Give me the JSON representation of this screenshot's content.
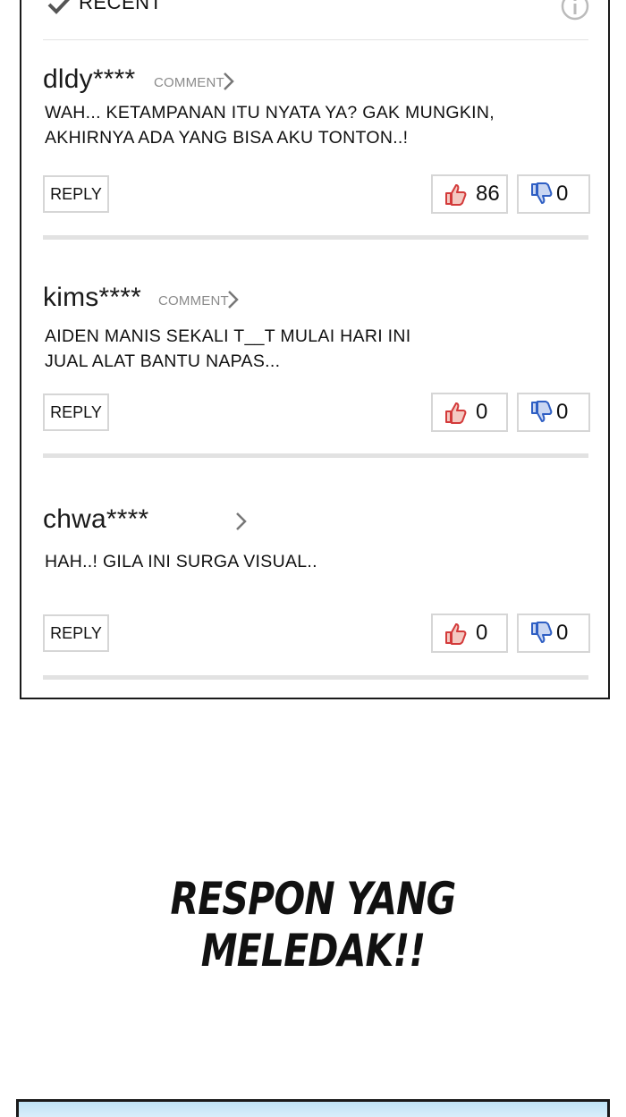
{
  "header": {
    "recent_label": "RECENT"
  },
  "comments": [
    {
      "username": "dldy****",
      "link_label": "COMMENT",
      "text_line1": "WAH... KETAMPANAN ITU NYATA YA? GAK MUNGKIN,",
      "text_line2": "AKHIRNYA ADA YANG BISA AKU TONTON..!",
      "reply_label": "REPLY",
      "likes": "86",
      "dislikes": "0"
    },
    {
      "username": "kims****",
      "link_label": "COMMENT",
      "text_line1": "AIDEN MANIS SEKALI T__T MULAI HARI INI",
      "text_line2": "JUAL ALAT BANTU NAPAS...",
      "reply_label": "REPLY",
      "likes": "0",
      "dislikes": "0"
    },
    {
      "username": "chwa****",
      "link_label": "",
      "text_line1": "HAH..! GILA INI SURGA VISUAL..",
      "text_line2": "",
      "reply_label": "REPLY",
      "likes": "0",
      "dislikes": "0"
    }
  ],
  "caption": "RESPON YANG MELEDAK!!",
  "colors": {
    "like": "#d33a3a",
    "dislike": "#2f5fc4",
    "border": "#d6d6d6",
    "separator": "#e2e2e2"
  }
}
